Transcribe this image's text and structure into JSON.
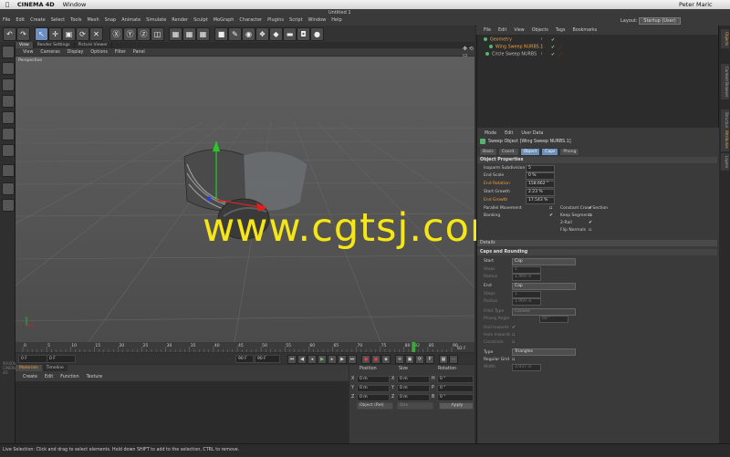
{
  "menubar": {
    "app": "CINEMA 4D",
    "window": "Window",
    "user": "Peter Maric"
  },
  "c4d_menu": [
    "File",
    "Edit",
    "Create",
    "Select",
    "Tools",
    "Mesh",
    "Snap",
    "Animate",
    "Simulate",
    "Render",
    "Sculpt",
    "MoGraph",
    "Character",
    "Plugins",
    "Script",
    "Window",
    "Help"
  ],
  "window_title": "Untitled 1",
  "layout": {
    "label": "Layout:",
    "value": "Startup (User)"
  },
  "viewport": {
    "tabs": [
      "View",
      "Render Settings",
      "Picture Viewer"
    ],
    "menu": [
      "View",
      "Cameras",
      "Display",
      "Options",
      "Filter",
      "Panel"
    ],
    "label": "Perspective"
  },
  "timeline": {
    "ticks": [
      "0",
      "5",
      "10",
      "15",
      "20",
      "25",
      "30",
      "35",
      "40",
      "45",
      "50",
      "55",
      "60",
      "65",
      "70",
      "75",
      "80",
      "82",
      "85",
      "90"
    ],
    "current_frame": "82 F",
    "start": "0 F",
    "end": "90 F",
    "end2": "90 F",
    "start2": "0 F"
  },
  "materials": {
    "tabs": [
      "Materials",
      "Timeline"
    ],
    "menu": [
      "Create",
      "Edit",
      "Function",
      "Texture"
    ]
  },
  "coordinates": {
    "headers": [
      "Position",
      "Size",
      "Rotation"
    ],
    "rows": [
      {
        "a": "X",
        "pos": "0 m",
        "b": "X",
        "size": "0 m",
        "c": "H",
        "rot": "0 °"
      },
      {
        "a": "Y",
        "pos": "0 m",
        "b": "Y",
        "size": "0 m",
        "c": "P",
        "rot": "0 °"
      },
      {
        "a": "Z",
        "pos": "0 m",
        "b": "Z",
        "size": "0 m",
        "c": "B",
        "rot": "0 °"
      }
    ],
    "mode": "Object (Rel)",
    "size_mode": "Size",
    "apply": "Apply"
  },
  "objects": {
    "menu": [
      "File",
      "Edit",
      "View",
      "Objects",
      "Tags",
      "Bookmarks"
    ],
    "items": [
      "Geometry",
      "Wing Sweep NURBS.1",
      "Circle Sweep NURBS"
    ]
  },
  "attributes": {
    "menu": [
      "Mode",
      "Edit",
      "User Data"
    ],
    "object": "Sweep Object [Wing Sweep NURBS.1]",
    "tabs": [
      "Basic",
      "Coord.",
      "Object",
      "Caps",
      "Phong"
    ],
    "object_props": "Object Properties",
    "props": [
      {
        "label": "Isoparm Subdivision",
        "value": "5"
      },
      {
        "label": "End Scale",
        "value": "0 %"
      },
      {
        "label": "End Rotation",
        "value": "158.662 °"
      },
      {
        "label": "Start Growth",
        "value": "2.23 %"
      },
      {
        "label": "End Growth",
        "value": "17.543 %"
      }
    ],
    "checks_left": [
      "Parallel Movement",
      "Banking"
    ],
    "checks_right": [
      "Constant Cross Section",
      "Keep Segments",
      "2-Rail",
      "Flip Normals"
    ],
    "details": "Details",
    "caps_section": "Caps and Rounding",
    "start": {
      "label": "Start",
      "value": "Cap"
    },
    "steps1": {
      "label": "Steps",
      "value": "1"
    },
    "radius1": {
      "label": "Radius",
      "value": "1.969 in"
    },
    "end": {
      "label": "End",
      "value": "Cap"
    },
    "steps2": {
      "label": "Steps",
      "value": "1"
    },
    "radius2": {
      "label": "Radius",
      "value": "1.969 in"
    },
    "fillet_type": {
      "label": "Fillet Type",
      "value": "Convex"
    },
    "phong_angle": {
      "label": "Phong Angle",
      "value": "60 °"
    },
    "hull_inwards": "Hull Inwards",
    "hole_inwards": "Hole Inwards",
    "constrain": "Constrain",
    "type": {
      "label": "Type",
      "value": "Triangles"
    },
    "regular_grid": "Regular Grid",
    "width": {
      "label": "Width",
      "value": "3.937 in"
    }
  },
  "right_tabs": [
    "Objects",
    "Content Browser",
    "Structure",
    "Attributes",
    "Layers"
  ],
  "status": "Live Selection: Click and drag to select elements. Hold down SHIFT to add to the selection, CTRL to remove.",
  "watermark": "www.cgtsj.com",
  "colors": {
    "accent": "#e6a04a",
    "watermark": "#f5e61a",
    "viewport": "#5a5a5a"
  }
}
